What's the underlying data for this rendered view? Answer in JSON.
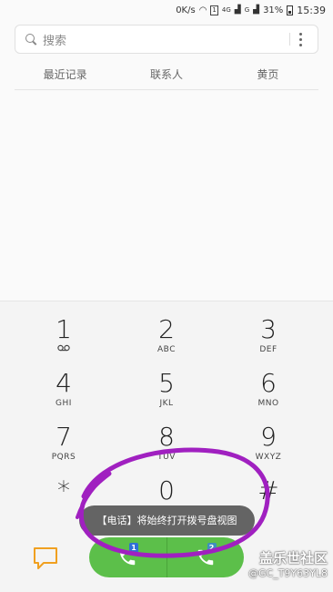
{
  "status_bar": {
    "speed": "0K/s",
    "sim1": "1",
    "net_4g": "4G",
    "net_g": "G",
    "battery": "31%",
    "time": "15:39"
  },
  "search": {
    "placeholder": "搜索"
  },
  "tabs": [
    {
      "label": "最近记录"
    },
    {
      "label": "联系人"
    },
    {
      "label": "黄页"
    }
  ],
  "keypad": [
    {
      "digit": "1",
      "letters": ""
    },
    {
      "digit": "2",
      "letters": "ABC"
    },
    {
      "digit": "3",
      "letters": "DEF"
    },
    {
      "digit": "4",
      "letters": "GHI"
    },
    {
      "digit": "5",
      "letters": "JKL"
    },
    {
      "digit": "6",
      "letters": "MNO"
    },
    {
      "digit": "7",
      "letters": "PQRS"
    },
    {
      "digit": "8",
      "letters": "TUV"
    },
    {
      "digit": "9",
      "letters": "WXYZ"
    },
    {
      "digit": "*",
      "letters": ""
    },
    {
      "digit": "0",
      "letters": ""
    },
    {
      "digit": "#",
      "letters": ""
    }
  ],
  "call_buttons": [
    {
      "sim": "1",
      "sim_color": "#2f6fd6"
    },
    {
      "sim": "2",
      "sim_color": "#3f8fbf"
    }
  ],
  "toast": "【电话】将始终打开拨号盘视图",
  "watermark": {
    "line1": "盖乐世社区",
    "line2": "@GC_T9Y63YL8"
  },
  "colors": {
    "call_green": "#5cbf4a",
    "annotation_purple": "#a020c0",
    "chat_icon": "#f0a020"
  }
}
